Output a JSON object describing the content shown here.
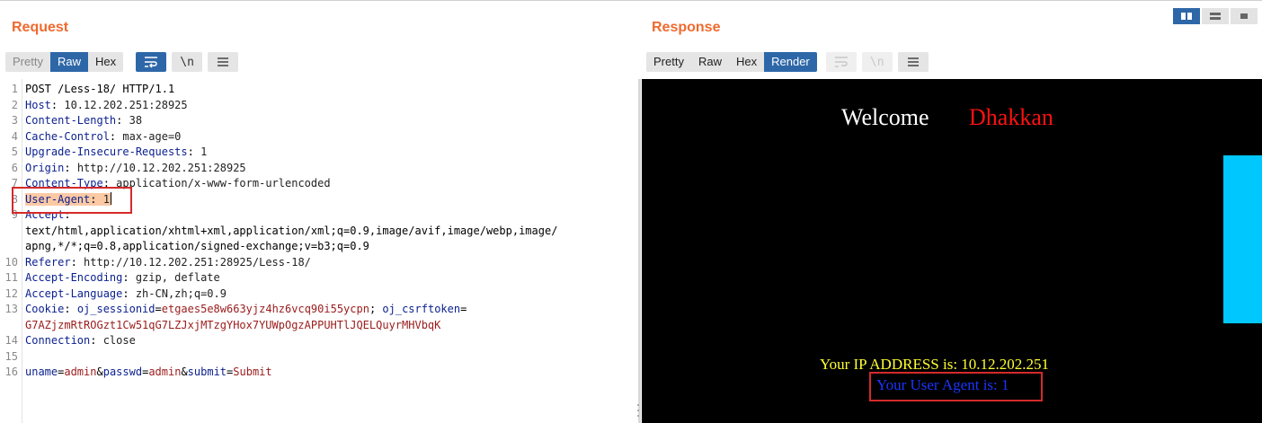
{
  "request": {
    "title": "Request",
    "tabs": [
      {
        "label": "Pretty",
        "state": "dim"
      },
      {
        "label": "Raw",
        "state": "active"
      },
      {
        "label": "Hex",
        "state": "normal"
      }
    ],
    "icons": [
      "wrap-lines-icon",
      "newline-icon",
      "menu-icon"
    ],
    "newline_label": "\\n",
    "lines": [
      {
        "n": "1",
        "text": "POST /Less-18/ HTTP/1.1"
      },
      {
        "n": "2",
        "key": "Host",
        "val": "10.12.202.251:28925"
      },
      {
        "n": "3",
        "key": "Content-Length",
        "val": "38"
      },
      {
        "n": "4",
        "key": "Cache-Control",
        "val": "max-age=0"
      },
      {
        "n": "5",
        "key": "Upgrade-Insecure-Requests",
        "val": "1"
      },
      {
        "n": "6",
        "key": "Origin",
        "val": "http://10.12.202.251:28925"
      },
      {
        "n": "7",
        "key": "Content-Type",
        "val": "application/x-www-form-urlencoded"
      },
      {
        "n": "8",
        "key": "User-Agent",
        "val": "1"
      },
      {
        "n": "9",
        "key": "Accept",
        "val": ""
      },
      {
        "n": "",
        "text": "text/html,application/xhtml+xml,application/xml;q=0.9,image/avif,image/webp,image/"
      },
      {
        "n": "",
        "text": "apng,*/*;q=0.8,application/signed-exchange;v=b3;q=0.9"
      },
      {
        "n": "10",
        "key": "Referer",
        "val": "http://10.12.202.251:28925/Less-18/"
      },
      {
        "n": "11",
        "key": "Accept-Encoding",
        "val": "gzip, deflate"
      },
      {
        "n": "12",
        "key": "Accept-Language",
        "val": "zh-CN,zh;q=0.9"
      },
      {
        "n": "13",
        "key": "Cookie",
        "cookie1_name": "oj_sessionid",
        "cookie1_val": "etgaes5e8w663yjz4hz6vcq90i55ycpn",
        "cookie2_name": "oj_csrftoken"
      },
      {
        "n": "",
        "text": "G7AZjzmRtROGzt1Cw51qG7LZJxjMTzgYHox7YUWpOgzAPPUHTlJQELQuyrMHVbqK"
      },
      {
        "n": "14",
        "key": "Connection",
        "val": "close"
      },
      {
        "n": "15",
        "text": ""
      },
      {
        "n": "16",
        "params": [
          [
            "uname",
            "admin"
          ],
          [
            "passwd",
            "admin"
          ],
          [
            "submit",
            "Submit"
          ]
        ]
      }
    ]
  },
  "response": {
    "title": "Response",
    "tabs": [
      {
        "label": "Pretty",
        "state": "normal"
      },
      {
        "label": "Raw",
        "state": "normal"
      },
      {
        "label": "Hex",
        "state": "normal"
      },
      {
        "label": "Render",
        "state": "active"
      }
    ],
    "newline_label": "\\n",
    "render": {
      "welcome": "Welcome",
      "name": "Dhakkan",
      "ip_text": "Your IP ADDRESS is: 10.12.202.251",
      "ua_text": "Your User Agent is: 1"
    }
  },
  "colors": {
    "title": "#f06a2e",
    "accent": "#2e67a8",
    "highlight": "#fbc9a4",
    "annotation": "#d42a2a"
  }
}
